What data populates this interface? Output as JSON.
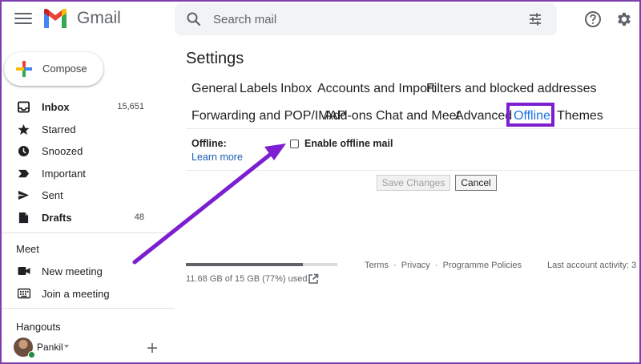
{
  "app": {
    "name": "Gmail"
  },
  "search": {
    "placeholder": "Search mail"
  },
  "compose": {
    "label": "Compose"
  },
  "nav": [
    {
      "label": "Inbox",
      "count": "15,651",
      "icon": "inbox-icon",
      "bold": true
    },
    {
      "label": "Starred",
      "count": "",
      "icon": "star-icon",
      "bold": false
    },
    {
      "label": "Snoozed",
      "count": "",
      "icon": "clock-icon",
      "bold": false
    },
    {
      "label": "Important",
      "count": "",
      "icon": "important-icon",
      "bold": false
    },
    {
      "label": "Sent",
      "count": "",
      "icon": "send-icon",
      "bold": false
    },
    {
      "label": "Drafts",
      "count": "48",
      "icon": "draft-icon",
      "bold": true
    }
  ],
  "meet": {
    "title": "Meet",
    "items": [
      {
        "label": "New meeting",
        "icon": "video-icon"
      },
      {
        "label": "Join a meeting",
        "icon": "keyboard-icon"
      }
    ]
  },
  "hangouts": {
    "title": "Hangouts",
    "user": "Pankil"
  },
  "settings": {
    "title": "Settings",
    "tabs_row1": [
      "General",
      "Labels",
      "Inbox",
      "Accounts and Import",
      "Filters and blocked addresses"
    ],
    "tabs_row2": [
      "Forwarding and POP/IMAP",
      "Add-ons",
      "Chat and Meet",
      "Advanced",
      "Offline",
      "Themes"
    ],
    "active_tab": "Offline",
    "offline_label": "Offline:",
    "learn_more": "Learn more",
    "enable_offline_label": "Enable offline mail",
    "enable_offline_checked": false,
    "save_label": "Save Changes",
    "cancel_label": "Cancel"
  },
  "storage": {
    "used_text": "11.68 GB of 15 GB (77%) used",
    "used_fraction": 0.77
  },
  "footer": {
    "terms": "Terms",
    "privacy": "Privacy",
    "policies": "Programme Policies",
    "separator": "·",
    "last_activity": "Last account activity: 3"
  },
  "colors": {
    "accent": "#1a73e8",
    "annotation": "#7b1fd0",
    "frame": "#7d3fb0"
  }
}
